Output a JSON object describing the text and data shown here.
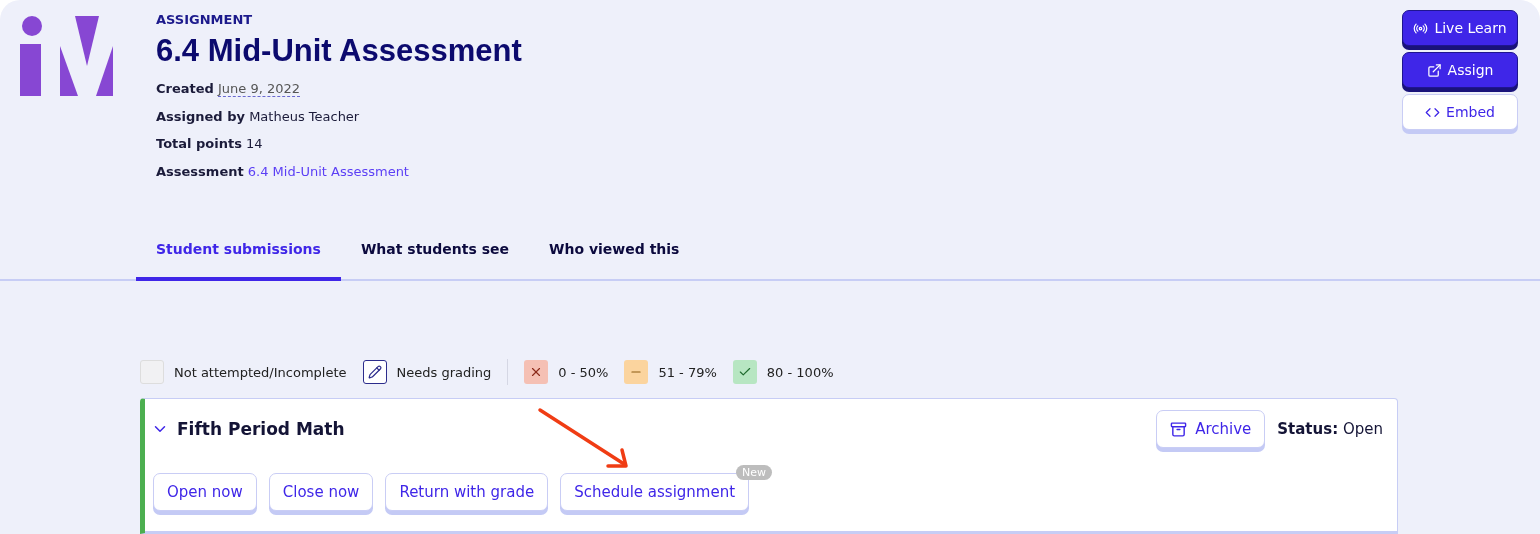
{
  "header": {
    "eyebrow": "ASSIGNMENT",
    "title": "6.4 Mid-Unit Assessment",
    "meta": [
      {
        "label": "Created",
        "value": "June 9, 2022",
        "kind": "date"
      },
      {
        "label": "Assigned by",
        "value": "Matheus Teacher",
        "kind": "plain"
      },
      {
        "label": "Total points",
        "value": "14",
        "kind": "plain"
      },
      {
        "label": "Assessment",
        "value": "6.4 Mid-Unit Assessment",
        "kind": "link"
      }
    ]
  },
  "actions": [
    {
      "label": "Live Learn",
      "kind": "live",
      "primary": true
    },
    {
      "label": "Assign",
      "kind": "external",
      "primary": true
    },
    {
      "label": "Embed",
      "kind": "code",
      "primary": false
    }
  ],
  "tabs": [
    {
      "label": "Student submissions",
      "selected": true
    },
    {
      "label": "What students see",
      "selected": false
    },
    {
      "label": "Who viewed this",
      "selected": false
    }
  ],
  "legend": [
    {
      "label": "Not attempted/Incomplete",
      "kind": "blank",
      "color": "#f1f1f3"
    },
    {
      "label": "Needs grading",
      "kind": "pencil",
      "color": "#ffffff"
    },
    {
      "label": "0 - 50%",
      "kind": "cross",
      "color": "#f5c0b4"
    },
    {
      "label": "51 - 79%",
      "kind": "dash",
      "color": "#fbd49e"
    },
    {
      "label": "80 - 100%",
      "kind": "check",
      "color": "#b7e6c2"
    }
  ],
  "class": {
    "name": "Fifth Period Math",
    "expanded": true,
    "archive": "Archive",
    "status_label": "Status:",
    "status": "Open",
    "buttons": [
      {
        "label": "Open now"
      },
      {
        "label": "Close now"
      },
      {
        "label": "Return with grade"
      },
      {
        "label": "Schedule assignment",
        "badge": "New"
      }
    ]
  }
}
